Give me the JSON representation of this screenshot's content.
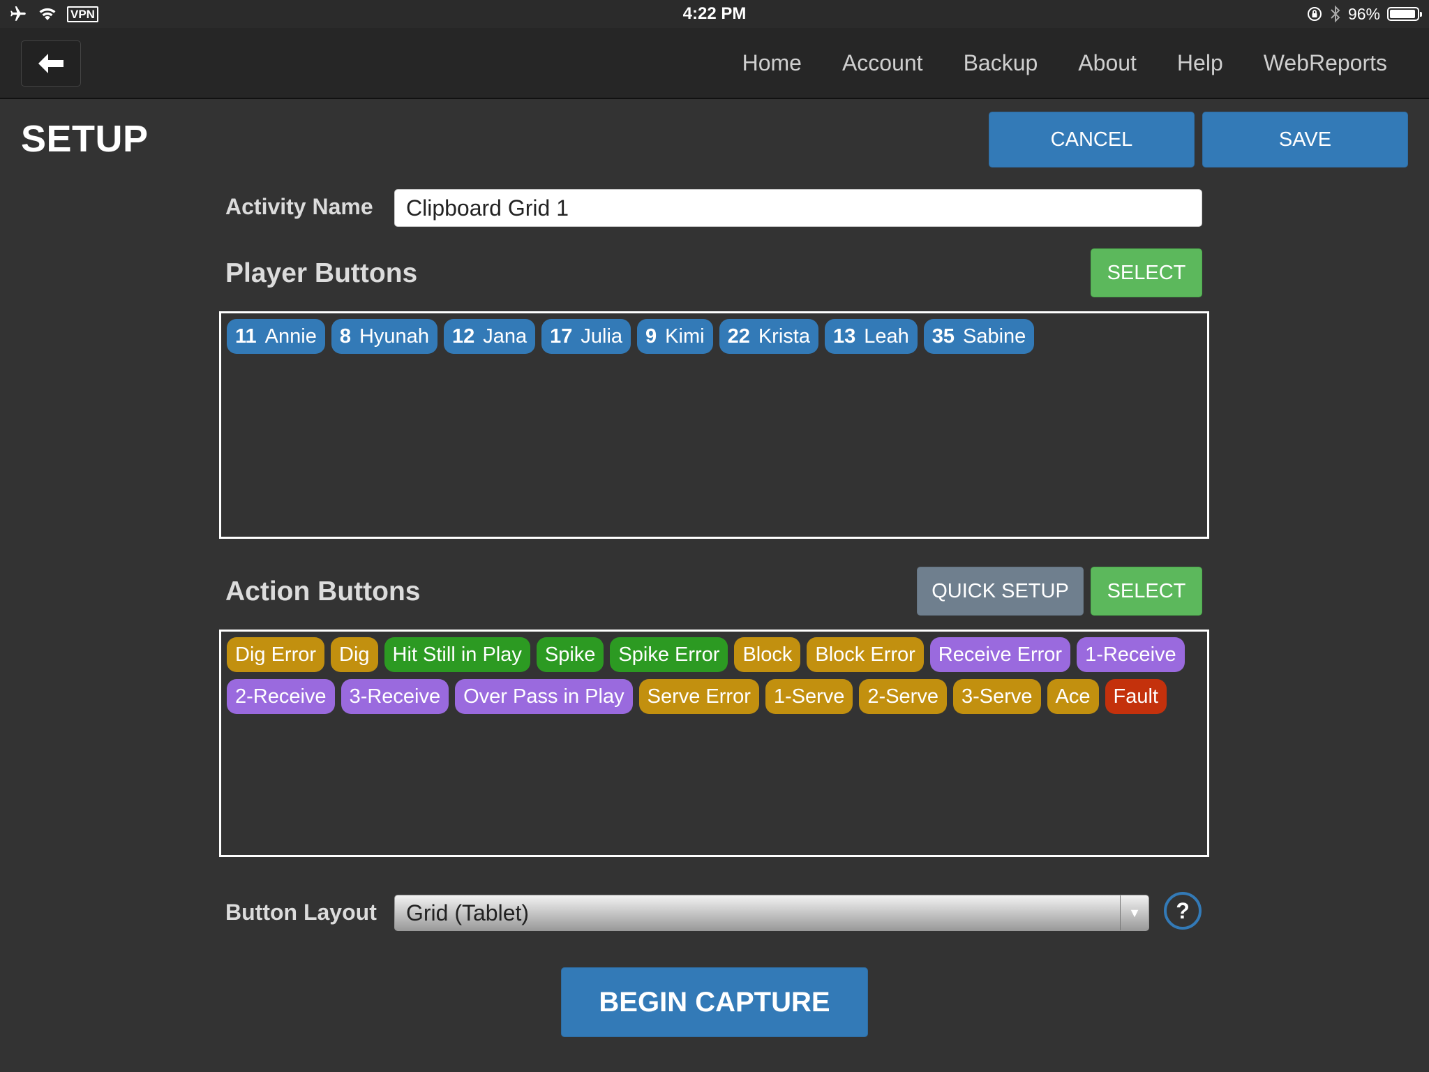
{
  "status_bar": {
    "vpn": "VPN",
    "time": "4:22 PM",
    "battery": "96%",
    "battery_level": 0.96,
    "icons": [
      "airplane-icon",
      "wifi-icon",
      "vpn-badge",
      "orientation-lock-icon",
      "bluetooth-icon",
      "battery-icon"
    ]
  },
  "nav": {
    "back_icon": "arrow-left-icon",
    "links": [
      "Home",
      "Account",
      "Backup",
      "About",
      "Help",
      "WebReports"
    ]
  },
  "page": {
    "title": "SETUP",
    "cancel_label": "CANCEL",
    "save_label": "SAVE"
  },
  "activity": {
    "label": "Activity Name",
    "value": "Clipboard Grid 1"
  },
  "player_section": {
    "title": "Player Buttons",
    "select_label": "SELECT",
    "players": [
      {
        "number": "11",
        "name": "Annie"
      },
      {
        "number": "8",
        "name": "Hyunah"
      },
      {
        "number": "12",
        "name": "Jana"
      },
      {
        "number": "17",
        "name": "Julia"
      },
      {
        "number": "9",
        "name": "Kimi"
      },
      {
        "number": "22",
        "name": "Krista"
      },
      {
        "number": "13",
        "name": "Leah"
      },
      {
        "number": "35",
        "name": "Sabine"
      }
    ]
  },
  "action_section": {
    "title": "Action Buttons",
    "quick_setup_label": "QUICK SETUP",
    "select_label": "SELECT",
    "colors": {
      "gold": "#c2900f",
      "green": "#2c9a22",
      "purple": "#9a6ade",
      "red": "#c4310c"
    },
    "actions": [
      {
        "label": "Dig Error",
        "color": "gold"
      },
      {
        "label": "Dig",
        "color": "gold"
      },
      {
        "label": "Hit Still in Play",
        "color": "green"
      },
      {
        "label": "Spike",
        "color": "green"
      },
      {
        "label": "Spike Error",
        "color": "green"
      },
      {
        "label": "Block",
        "color": "gold"
      },
      {
        "label": "Block Error",
        "color": "gold"
      },
      {
        "label": "Receive Error",
        "color": "purple"
      },
      {
        "label": "1-Receive",
        "color": "purple"
      },
      {
        "label": "2-Receive",
        "color": "purple"
      },
      {
        "label": "3-Receive",
        "color": "purple"
      },
      {
        "label": "Over Pass in Play",
        "color": "purple"
      },
      {
        "label": "Serve Error",
        "color": "gold"
      },
      {
        "label": "1-Serve",
        "color": "gold"
      },
      {
        "label": "2-Serve",
        "color": "gold"
      },
      {
        "label": "3-Serve",
        "color": "gold"
      },
      {
        "label": "Ace",
        "color": "gold"
      },
      {
        "label": "Fault",
        "color": "red"
      }
    ]
  },
  "layout": {
    "label": "Button Layout",
    "selected": "Grid (Tablet)",
    "dropdown_icon": "triangle-down-icon",
    "help_icon": "question-circle-icon",
    "help_glyph": "?"
  },
  "begin_label": "BEGIN CAPTURE",
  "theme": {
    "background": "#333333",
    "accent_blue": "#337ab7",
    "accent_green": "#5cb85c",
    "neutral_gray": "#6f7f8e"
  }
}
